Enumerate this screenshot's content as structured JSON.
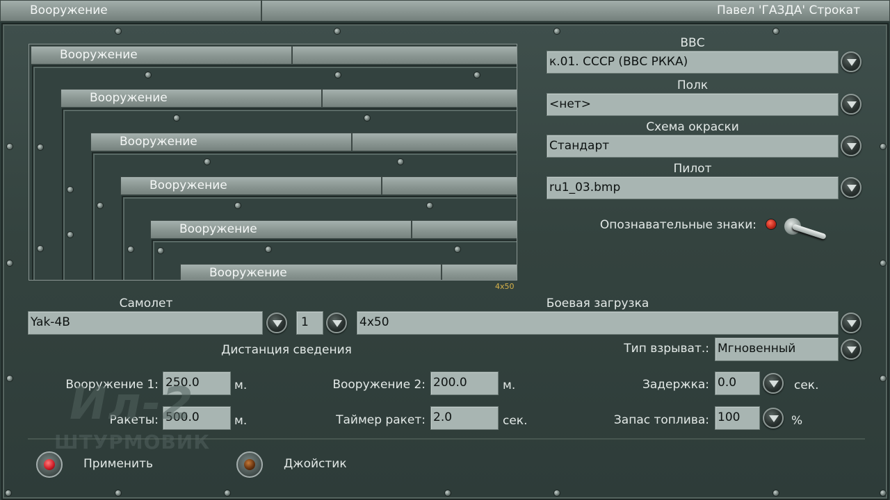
{
  "window": {
    "title": "Вооружение",
    "user": "Павел 'ГАЗДА' Строкат"
  },
  "preview": {
    "bar_label": "Вооружение",
    "caption": "4x50"
  },
  "air_force": {
    "label": "ВВС",
    "value": "к.01. СССР (ВВС РККА)"
  },
  "regiment": {
    "label": "Полк",
    "value": "<нет>"
  },
  "paint_scheme": {
    "label": "Схема окраски",
    "value": "Стандарт"
  },
  "pilot": {
    "label": "Пилот",
    "value": "ru1_03.bmp"
  },
  "markings": {
    "label": "Опознавательные знаки:",
    "enabled": true
  },
  "aircraft": {
    "label": "Самолет",
    "value": "Yak-4B",
    "count": "1"
  },
  "loadout": {
    "label": "Боевая загрузка",
    "value": "4x50"
  },
  "convergence": {
    "label": "Дистанция сведения"
  },
  "fuze": {
    "label": "Тип взрыват.:",
    "value": "Мгновенный"
  },
  "weapon1": {
    "label": "Вооружение 1:",
    "value": "250.0",
    "unit": "м."
  },
  "weapon2": {
    "label": "Вооружение 2:",
    "value": "200.0",
    "unit": "м."
  },
  "delay": {
    "label": "Задержка:",
    "value": "0.0",
    "unit": "сек."
  },
  "rockets": {
    "label": "Ракеты:",
    "value": "500.0",
    "unit": "м."
  },
  "rocket_timer": {
    "label": "Таймер ракет:",
    "value": "2.0",
    "unit": "сек."
  },
  "fuel": {
    "label": "Запас топлива:",
    "value": "100",
    "unit": "%"
  },
  "logo": {
    "line1": "Ил-2",
    "line2": "ШТУРМОВИК"
  },
  "buttons": {
    "apply": "Применить",
    "joystick": "Джойстик"
  },
  "colors": {
    "apply_lamp": "#d0202a",
    "joystick_lamp": "#6a3510",
    "markings_lamp": "#c42a1c"
  }
}
